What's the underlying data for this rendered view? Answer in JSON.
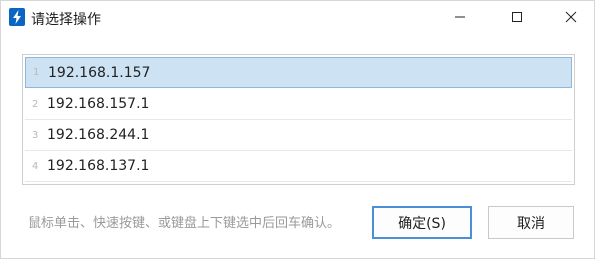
{
  "window": {
    "title": "请选择操作",
    "icon": "lightning-bolt-icon",
    "accent_color": "#0a66c2"
  },
  "list": {
    "items": [
      {
        "index": "1",
        "label": "192.168.1.157",
        "selected": true
      },
      {
        "index": "2",
        "label": "192.168.157.1",
        "selected": false
      },
      {
        "index": "3",
        "label": "192.168.244.1",
        "selected": false
      },
      {
        "index": "4",
        "label": "192.168.137.1",
        "selected": false
      }
    ],
    "selected_color": "#cde3f4"
  },
  "footer": {
    "hint": "鼠标单击、快速按键、或键盘上下键选中后回车确认。",
    "ok_label": "确定(S)",
    "cancel_label": "取消"
  }
}
